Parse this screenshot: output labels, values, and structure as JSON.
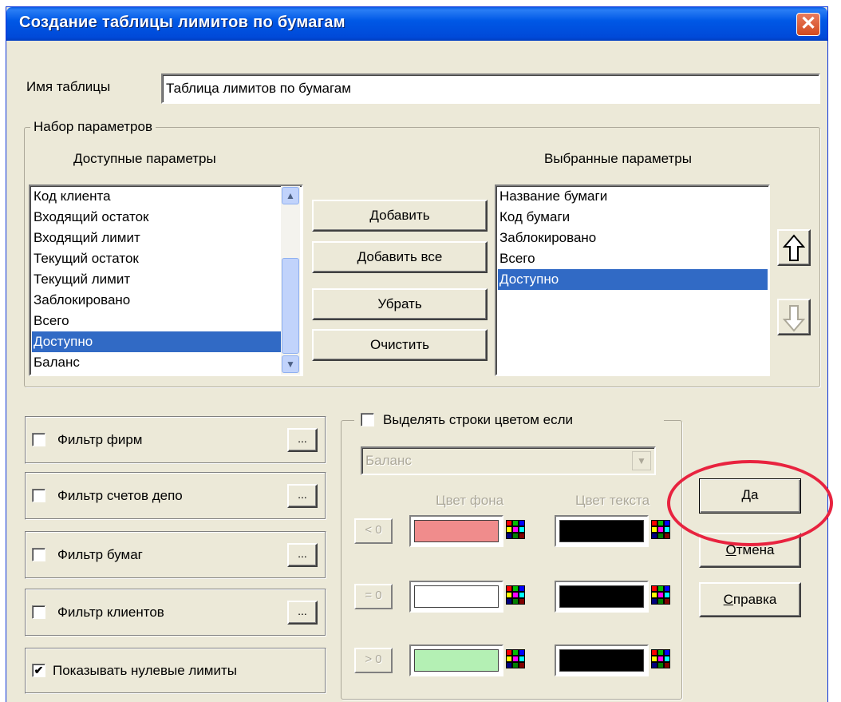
{
  "window": {
    "title": "Создание таблицы лимитов по бумагам",
    "close_glyph": "✕"
  },
  "table_name": {
    "label": "Имя таблицы",
    "value": "Таблица лимитов по бумагам"
  },
  "params_group": {
    "legend": "Набор параметров",
    "available_header": "Доступные параметры",
    "selected_header": "Выбранные параметры",
    "available_items": [
      "Код клиента",
      "Входящий остаток",
      "Входящий лимит",
      "Текущий остаток",
      "Текущий лимит",
      "Заблокировано",
      "Всего",
      "Доступно",
      "Баланс"
    ],
    "available_selected_index": 7,
    "selected_items": [
      "Название бумаги",
      "Код бумаги",
      "Заблокировано",
      "Всего",
      "Доступно"
    ],
    "selected_selected_index": 4,
    "buttons": {
      "add": "Добавить",
      "add_all": "Добавить все",
      "remove": "Убрать",
      "clear": "Очистить"
    },
    "move_up_icon": "up-arrow-icon",
    "move_down_icon": "down-arrow-icon"
  },
  "filters": [
    {
      "label": "Фильтр фирм",
      "checked": false,
      "button": "..."
    },
    {
      "label": "Фильтр счетов депо",
      "checked": false,
      "button": "..."
    },
    {
      "label": "Фильтр бумаг",
      "checked": false,
      "button": "..."
    },
    {
      "label": "Фильтр клиентов",
      "checked": false,
      "button": "..."
    }
  ],
  "show_zero": {
    "label": "Показывать нулевые лимиты",
    "checked": true,
    "check_glyph": "✔"
  },
  "highlight": {
    "label": "Выделять строки цветом если",
    "checked": false,
    "field_value": "Баланс",
    "bg_header": "Цвет фона",
    "text_header": "Цвет текста",
    "rows": [
      {
        "cond": "< 0",
        "bg": "#f08c8c",
        "text": "#000000"
      },
      {
        "cond": "= 0",
        "bg": "#ffffff",
        "text": "#000000"
      },
      {
        "cond": "> 0",
        "bg": "#b4f0b4",
        "text": "#000000"
      }
    ]
  },
  "actions": {
    "ok": {
      "mnemonic": "Д",
      "rest": "а"
    },
    "cancel": {
      "mnemonic": "О",
      "rest": "тмена"
    },
    "help": {
      "mnemonic": "С",
      "rest": "правка"
    }
  },
  "colors": {
    "title_bar": "#0054e3",
    "selection": "#316ac5",
    "annotation_circle": "#e8233f"
  }
}
